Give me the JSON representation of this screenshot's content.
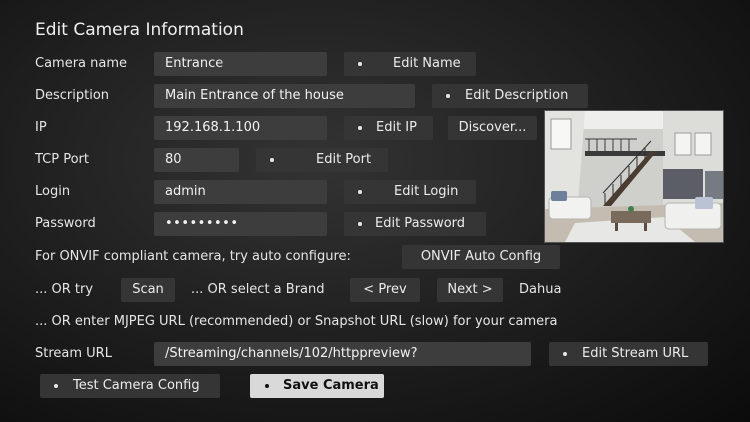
{
  "title": "Edit Camera Information",
  "rows": {
    "name": {
      "label": "Camera name",
      "value": "Entrance",
      "button": "Edit Name"
    },
    "description": {
      "label": "Description",
      "value": "Main Entrance of the house",
      "button": "Edit Description"
    },
    "ip": {
      "label": "IP",
      "value": "192.168.1.100",
      "button": "Edit IP",
      "discover": "Discover..."
    },
    "port": {
      "label": "TCP Port",
      "value": "80",
      "button": "Edit Port"
    },
    "login": {
      "label": "Login",
      "value": "admin",
      "button": "Edit Login"
    },
    "password": {
      "label": "Password",
      "value": "•••••••••",
      "button": "Edit Password"
    }
  },
  "onvif": {
    "text": "For ONVIF compliant camera, try auto configure:",
    "button": "ONVIF Auto Config"
  },
  "brand": {
    "or_try": "... OR try",
    "scan": "Scan",
    "or_select": "... OR select a Brand",
    "prev": "< Prev",
    "next": "Next >",
    "selected_brand": "Dahua"
  },
  "mjpeg_hint": "... OR enter MJPEG URL (recommended) or Snapshot URL (slow) for your camera",
  "stream": {
    "label": "Stream URL",
    "value": "/Streaming/channels/102/httppreview?",
    "button": "Edit Stream URL"
  },
  "actions": {
    "test": "Test Camera Config",
    "save": "Save Camera"
  },
  "preview": {
    "icon": "camera-snapshot-image"
  },
  "colors": {
    "background": "#1d1d1d",
    "field": "#3d3d3d",
    "button": "#353535",
    "selected_button": "#d9d9d9"
  }
}
